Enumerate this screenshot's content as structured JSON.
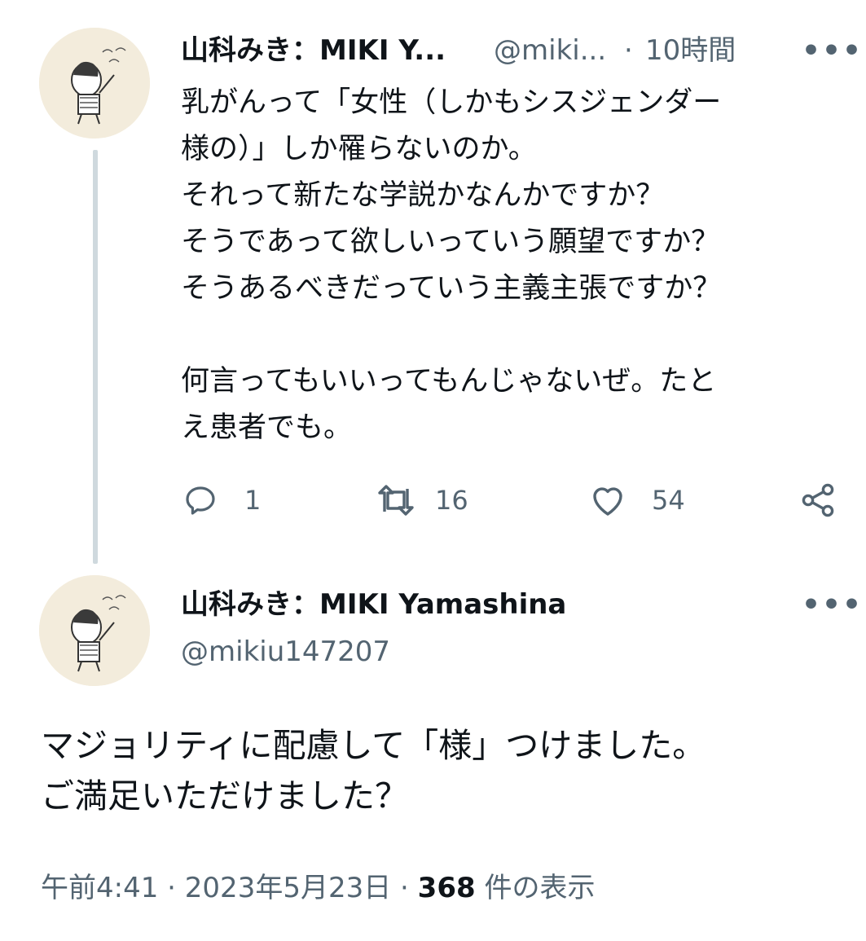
{
  "reply_tweet": {
    "display_name": "山科みき：MIKI Y...",
    "handle": "@miki...",
    "separator": "·",
    "time": "10時間",
    "more": "•••",
    "text": "乳がんって「女性（しかもシスジェンダー\n様の）」しか罹らないのか。\nそれって新たな学説かなんかですか？\nそうであって欲しいっていう願望ですか？\nそうあるべきだっていう主義主張ですか？\n\n何言ってもいいってもんじゃないぜ。たと\nえ患者でも。",
    "reply_count": "1",
    "retweet_count": "16",
    "like_count": "54"
  },
  "main_tweet": {
    "display_name": "山科みき：MIKI Yamashina",
    "handle": "@mikiu147207",
    "more": "•••",
    "text": "マジョリティに配慮して「様」つけました。\nご満足いただけました？",
    "time": "午前4:41",
    "sep1": "·",
    "date": "2023年5月23日",
    "sep2": "·",
    "views": "368",
    "views_label": "件の表示"
  },
  "icons": [
    "avatar",
    "reply-icon",
    "retweet-icon",
    "like-icon",
    "share-icon",
    "more-icon"
  ],
  "colors": {
    "text": "#0f1419",
    "secondary": "#536471",
    "thread_line": "#cfd9de",
    "avatar_bg": "#f3ecdc"
  }
}
